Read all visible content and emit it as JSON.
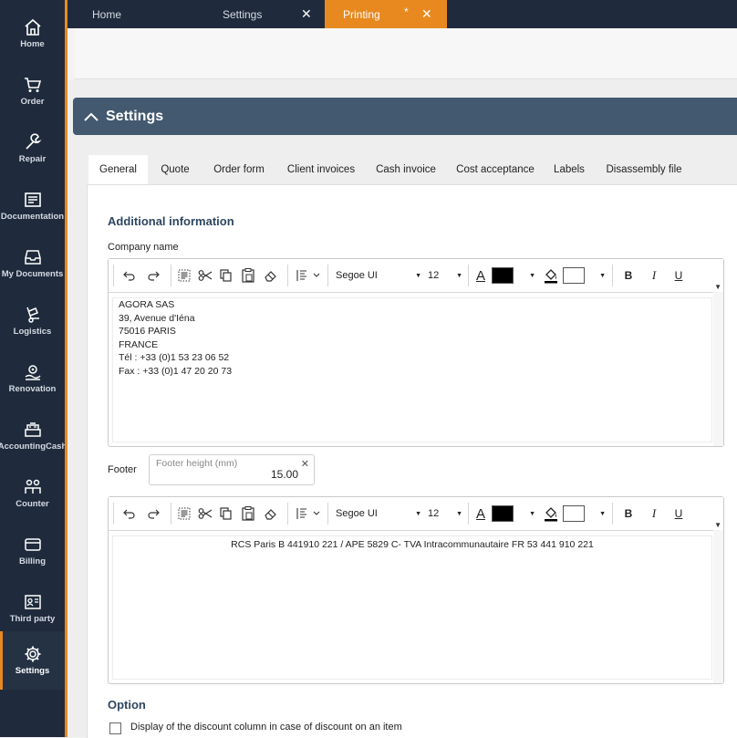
{
  "sidebar": {
    "items": [
      {
        "label": "Home",
        "icon": "home-icon"
      },
      {
        "label": "Order",
        "icon": "cart-icon"
      },
      {
        "label": "Repair",
        "icon": "wrench-icon"
      },
      {
        "label": "Documentation",
        "icon": "document-icon"
      },
      {
        "label": "My Documents",
        "icon": "inbox-icon"
      },
      {
        "label": "Logistics",
        "icon": "dolly-icon"
      },
      {
        "label": "Renovation",
        "icon": "renovation-icon"
      },
      {
        "label": "AccountingCash",
        "icon": "cash-register-icon"
      },
      {
        "label": "Counter",
        "icon": "people-icon"
      },
      {
        "label": "Billing",
        "icon": "card-icon"
      },
      {
        "label": "Third party",
        "icon": "id-card-icon"
      },
      {
        "label": "Settings",
        "icon": "gear-icon"
      }
    ],
    "active": "Settings"
  },
  "tabs": [
    {
      "label": "Home"
    },
    {
      "label": "Settings"
    },
    {
      "label": "Printing",
      "modified": "*"
    }
  ],
  "section": {
    "title": "Settings"
  },
  "subtabs": [
    "General",
    "Quote",
    "Order form",
    "Client invoices",
    "Cash invoice",
    "Cost acceptance",
    "Labels",
    "Disassembly file"
  ],
  "general": {
    "additional_info_heading": "Additional information",
    "company_name_label": "Company name",
    "footer_label": "Footer",
    "footer_height": {
      "placeholder": "Footer height (mm)",
      "value": "15.00"
    },
    "option_heading": "Option",
    "discount_option_label": "Display of the discount column in case of discount on an item"
  },
  "toolbar": {
    "font": "Segoe UI",
    "size": "12",
    "text_color": "#000000",
    "highlight_color": "#ffffff",
    "bold": "B",
    "italic": "I",
    "underline": "U",
    "font_color_glyph": "A"
  },
  "company_editor": {
    "lines": [
      "AGORA SAS",
      "39, Avenue d'Iéna",
      "75016 PARIS",
      "FRANCE",
      "Tél : +33 (0)1 53 23 06 52",
      "Fax : +33 (0)1 47 20 20 73"
    ]
  },
  "footer_editor": {
    "text": "RCS Paris B 441910 221 / APE 5829 C- TVA Intracommunautaire FR 53 441 910 221"
  },
  "colors": {
    "accent": "#e8891f",
    "sidebar": "#1f2b3c",
    "section_header": "#43596f",
    "heading_text": "#2e4660"
  }
}
